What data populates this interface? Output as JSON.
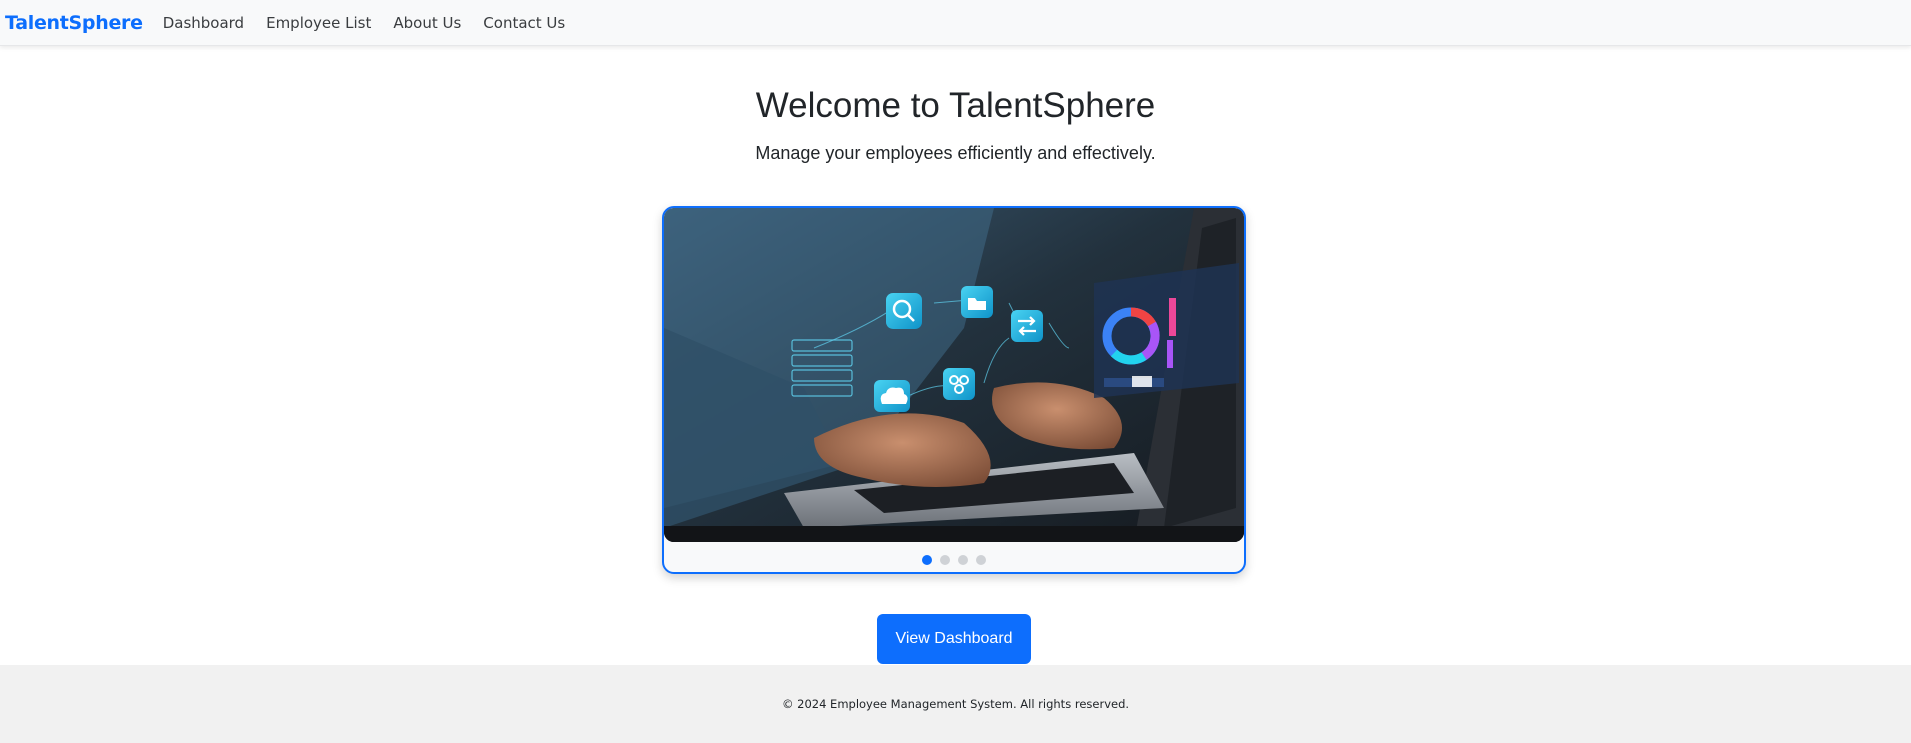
{
  "nav": {
    "brand": "TalentSphere",
    "links": [
      "Dashboard",
      "Employee List",
      "About Us",
      "Contact Us"
    ]
  },
  "hero": {
    "title": "Welcome to TalentSphere",
    "subtitle": "Manage your employees efficiently and effectively."
  },
  "carousel": {
    "slide_count": 4,
    "active_index": 0,
    "image_description_icons": [
      "search-icon",
      "folder-icon",
      "transfer-icon",
      "cloud-upload-icon",
      "network-icon",
      "server-rack-icon",
      "donut-chart-icon"
    ]
  },
  "cta": {
    "label": "View Dashboard"
  },
  "footer": {
    "text": "© 2024 Employee Management System. All rights reserved."
  },
  "colors": {
    "accent": "#0d6efd",
    "navbar_bg": "#f8f9fa",
    "footer_bg": "#f1f1f1"
  }
}
